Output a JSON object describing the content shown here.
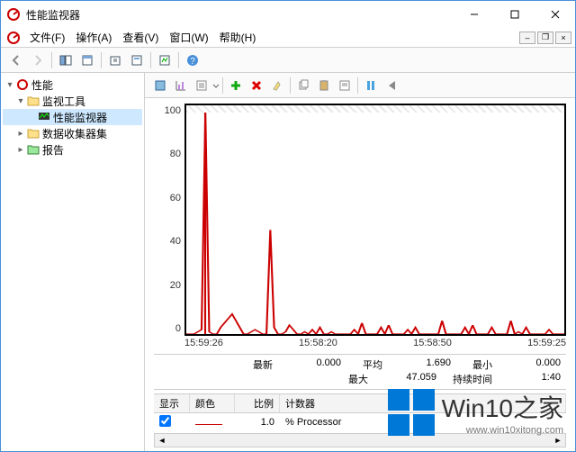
{
  "window": {
    "title": "性能监视器"
  },
  "menu": {
    "file": "文件(F)",
    "action": "操作(A)",
    "view": "查看(V)",
    "window": "窗口(W)",
    "help": "帮助(H)"
  },
  "tree": {
    "root": "性能",
    "monitoring_tools": "监视工具",
    "perf_monitor": "性能监视器",
    "data_collector_sets": "数据收集器集",
    "reports": "报告"
  },
  "chart": {
    "y0": "0",
    "y20": "20",
    "y40": "40",
    "y60": "60",
    "y80": "80",
    "y100": "100",
    "x0": "15:59:26",
    "x1": "15:58:20",
    "x2": "15:58:50",
    "x3": "15:59:25"
  },
  "stats": {
    "latest_label": "最新",
    "latest_val": "0.000",
    "avg_label": "平均",
    "avg_val": "1.690",
    "min_label": "最小",
    "min_val": "0.000",
    "max_label": "最大",
    "max_val": "47.059",
    "duration_label": "持续时间",
    "duration_val": "1:40"
  },
  "legend": {
    "hdr_show": "显示",
    "hdr_color": "颜色",
    "hdr_scale": "比例",
    "hdr_counter": "计数器",
    "row_scale": "1.0",
    "row_counter": "% Processor"
  },
  "watermark": {
    "big": "Win10之家",
    "small": "www.win10xitong.com"
  },
  "chart_data": {
    "type": "line",
    "title": "",
    "xlabel": "",
    "ylabel": "",
    "ylim": [
      0,
      100
    ],
    "x_ticks": [
      "15:59:26",
      "15:58:20",
      "15:58:50",
      "15:59:25"
    ],
    "series": [
      {
        "name": "% Processor",
        "color": "#c00000",
        "scale": 1.0,
        "values": [
          0,
          0,
          0,
          1,
          2,
          100,
          1,
          0,
          0,
          3,
          5,
          7,
          9,
          6,
          3,
          0,
          0,
          1,
          2,
          1,
          0,
          0,
          47,
          3,
          0,
          0,
          1,
          4,
          2,
          0,
          0,
          1,
          0,
          2,
          0,
          3,
          0,
          0,
          1,
          0,
          0,
          0,
          0,
          0,
          2,
          0,
          5,
          0,
          0,
          0,
          0,
          3,
          0,
          4,
          0,
          0,
          0,
          0,
          2,
          0,
          3,
          0,
          0,
          0,
          0,
          0,
          0,
          6,
          0,
          0,
          0,
          0,
          0,
          3,
          0,
          4,
          0,
          0,
          0,
          0,
          3,
          0,
          0,
          0,
          0,
          6,
          0,
          1,
          0,
          3,
          0,
          0,
          0,
          0,
          0,
          2,
          0,
          0,
          0,
          0
        ]
      }
    ],
    "summary": {
      "latest": 0.0,
      "average": 1.69,
      "min": 0.0,
      "max": 47.059,
      "duration": "1:40"
    }
  }
}
